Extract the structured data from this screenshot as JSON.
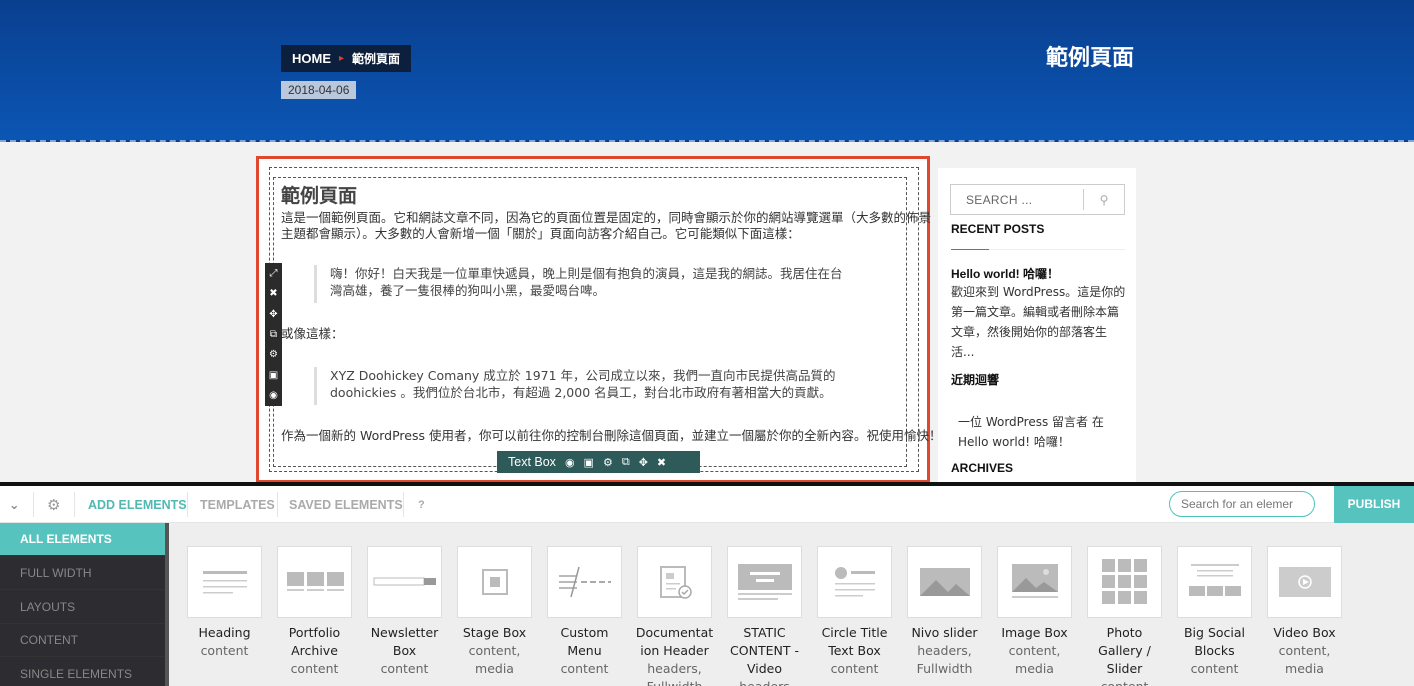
{
  "header": {
    "breadcrumb_home": "HOME",
    "breadcrumb_current": "範例頁面",
    "date": "2018-04-06",
    "page_title": "範例頁面"
  },
  "content": {
    "title": "範例頁面",
    "p1_line1": "這是一個範例頁面。它和網誌文章不同，因為它的頁面位置是固定的，同時會顯示於你的網站導覽選單（大多數的佈景",
    "p1_line2": "主題都會顯示）。大多數的人會新增一個「關於」頁面向訪客介紹自己。它可能類似下面這樣：",
    "quote1_line1": "嗨！你好！白天我是一位單車快遞員，晚上則是個有抱負的演員，這是我的網誌。我居住在台",
    "quote1_line2": "灣高雄，養了一隻很棒的狗叫小黑，最愛喝台啤。",
    "p2": "或像這樣：",
    "quote2_line1": "XYZ Doohickey Comany 成立於 1971 年，公司成立以來，我們一直向市民提供高品質的",
    "quote2_line2": "doohickies 。我們位於台北市，有超過 2,000 名員工，對台北市政府有著相當大的貢獻。",
    "p3": "作為一個新的 WordPress 使用者，你可以前往你的控制台刪除這個頁面，並建立一個屬於你的全新內容。祝使用愉快！",
    "element_label": "Text Box"
  },
  "sidebar": {
    "search_placeholder": "SEARCH ...",
    "recent_posts_heading": "RECENT POSTS",
    "post_title": "Hello world! 哈囉！",
    "post_excerpt_1": "歡迎來到 WordPress。這是你的",
    "post_excerpt_2": "第一篇文章。編輯或者刪除本篇",
    "post_excerpt_3": "文章，然後開始你的部落客生",
    "post_excerpt_4": "活...",
    "recent_comments_heading": "近期迴響",
    "comment_1": "一位 WordPress 留言者 在",
    "comment_2": "Hello world! 哈囉！",
    "archives_heading": "ARCHIVES"
  },
  "builder": {
    "tabs": [
      "ADD ELEMENTS",
      "TEMPLATES",
      "SAVED ELEMENTS"
    ],
    "help": "?",
    "search_placeholder": "Search for an elemer",
    "publish": "PUBLISH",
    "categories": [
      "ALL ELEMENTS",
      "FULL WIDTH",
      "LAYOUTS",
      "CONTENT",
      "SINGLE ELEMENTS"
    ],
    "elements": [
      {
        "name1": "Heading",
        "name2": "",
        "cat": "content"
      },
      {
        "name1": "Portfolio",
        "name2": "Archive",
        "cat": "content"
      },
      {
        "name1": "Newsletter",
        "name2": "Box",
        "cat": "content"
      },
      {
        "name1": "Stage Box",
        "name2": "content,",
        "cat": "media"
      },
      {
        "name1": "Custom",
        "name2": "Menu",
        "cat": "content"
      },
      {
        "name1": "Documentat",
        "name2": "ion Header",
        "cat": "headers,"
      },
      {
        "name1": "STATIC",
        "name2": "CONTENT -",
        "cat": "Video"
      },
      {
        "name1": "Circle Title",
        "name2": "Text Box",
        "cat": "content"
      },
      {
        "name1": "Nivo slider",
        "name2": "headers,",
        "cat": "Fullwidth"
      },
      {
        "name1": "Image Box",
        "name2": "content,",
        "cat": "media"
      },
      {
        "name1": "Photo",
        "name2": "Gallery /",
        "cat": "Slider"
      },
      {
        "name1": "Big Social",
        "name2": "Blocks",
        "cat": "content"
      },
      {
        "name1": "Video Box",
        "name2": "content,",
        "cat": "media"
      }
    ],
    "element_extra": [
      "Fullwidth",
      "headers",
      "content"
    ]
  },
  "colors": {
    "accent": "#57c3be",
    "header": "#0b56b4",
    "highlight": "#e0472f"
  }
}
